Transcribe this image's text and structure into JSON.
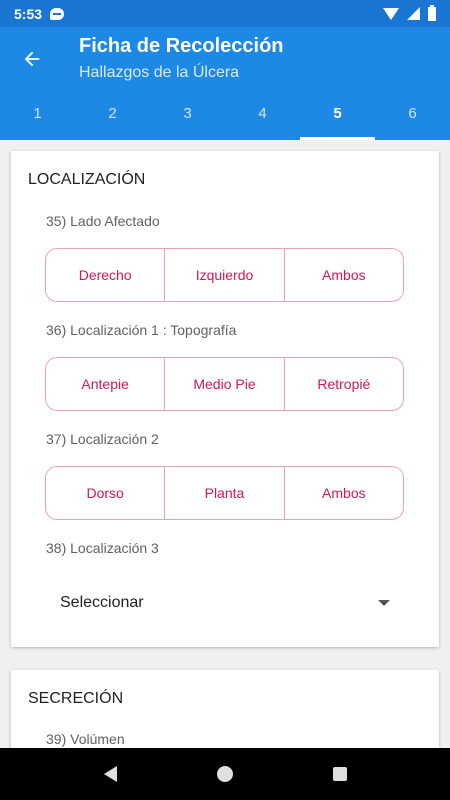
{
  "status": {
    "time": "5:53"
  },
  "app_bar": {
    "title": "Ficha de Recolección",
    "subtitle": "Hallazgos de la Úlcera",
    "back_icon": "arrow-left-icon",
    "tabs": [
      "1",
      "2",
      "3",
      "4",
      "5",
      "6"
    ],
    "active_tab": "5"
  },
  "section_localizacion": {
    "title": "LOCALIZACIÓN",
    "q35": {
      "label": "35) Lado Afectado",
      "options": [
        "Derecho",
        "Izquierdo",
        "Ambos"
      ]
    },
    "q36": {
      "label": "36) Localización 1 : Topografía",
      "options": [
        "Antepie",
        "Medio Pie",
        "Retropié"
      ]
    },
    "q37": {
      "label": "37) Localización 2",
      "options": [
        "Dorso",
        "Planta",
        "Ambos"
      ]
    },
    "q38": {
      "label": "38) Localización 3",
      "select_value": "Seleccionar"
    }
  },
  "section_secrecion": {
    "title": "SECRECIÓN",
    "q39": {
      "label": "39) Volúmen"
    }
  },
  "colors": {
    "primary": "#1e88e5",
    "accent": "#d0175a",
    "outline": "#f0a3b5"
  }
}
